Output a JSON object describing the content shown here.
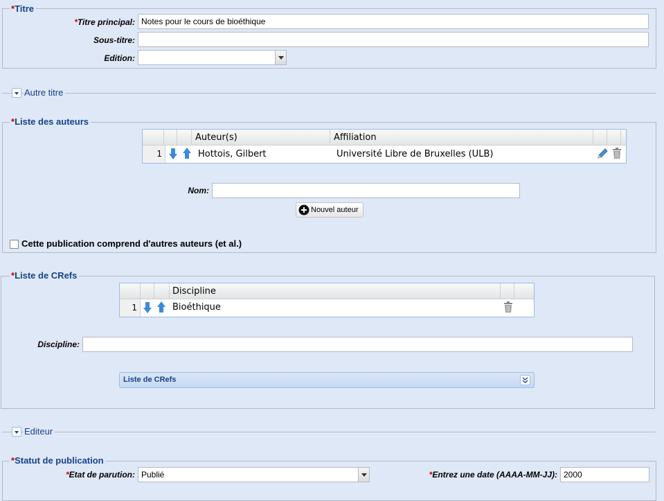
{
  "titre": {
    "legend": "Titre",
    "required_marker": "*",
    "titre_principal": {
      "label": "Titre principal:",
      "value": "Notes pour le cours de bioéthique"
    },
    "sous_titre": {
      "label": "Sous-titre:",
      "value": ""
    },
    "edition": {
      "label": "Edition:",
      "value": ""
    }
  },
  "autre_titre": {
    "label": "Autre titre"
  },
  "auteurs": {
    "legend": "Liste des auteurs",
    "columns": [
      "Auteur(s)",
      "Affiliation"
    ],
    "rows": [
      {
        "num": "1",
        "auteur": "Hottois, Gilbert",
        "affiliation": "Université Libre de Bruxelles (ULB)"
      }
    ],
    "nom": {
      "label": "Nom:",
      "value": ""
    },
    "nouvel_auteur_button": "Nouvel auteur",
    "et_al_label": "Cette publication comprend d'autres auteurs (et al.)",
    "et_al_checked": false
  },
  "crefs": {
    "legend": "Liste de CRefs",
    "columns": [
      "Discipline"
    ],
    "rows": [
      {
        "num": "1",
        "discipline": "Bioéthique"
      }
    ],
    "discipline": {
      "label": "Discipline:",
      "value": ""
    },
    "panel_title": "Liste de CRefs"
  },
  "editeur": {
    "label": "Editeur"
  },
  "statut": {
    "legend": "Statut de publication",
    "etat": {
      "label": "Etat de parution:",
      "value": "Publié"
    },
    "date": {
      "label": "Entrez une date (AAAA-MM-JJ):",
      "value": "2000"
    }
  },
  "colors": {
    "accent": "#15428b",
    "required": "#cc0000",
    "background": "#dfe8f6",
    "arrow": "#3c8ad8"
  }
}
